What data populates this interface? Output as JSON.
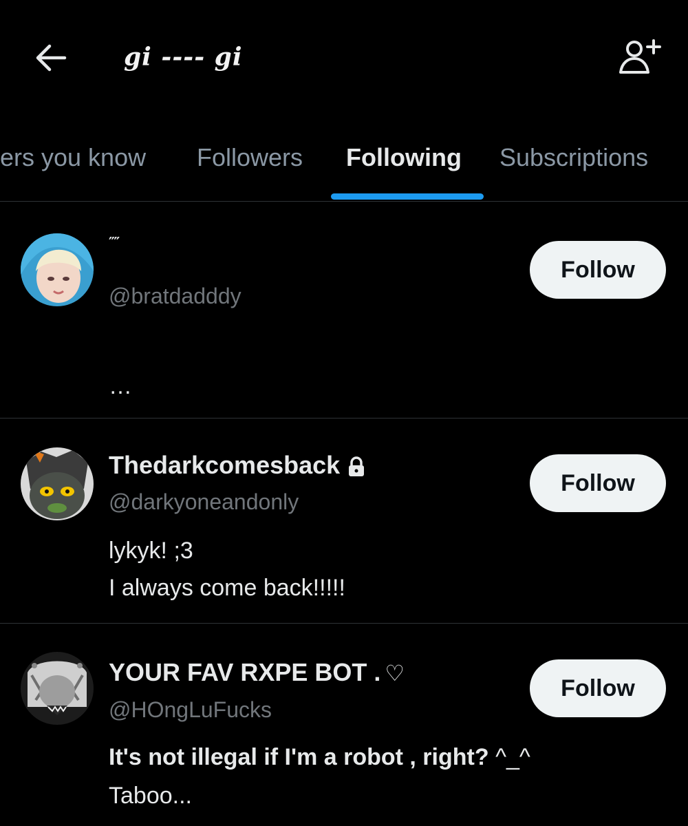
{
  "header": {
    "title": "gi ---- gi",
    "back_icon": "arrow-left-icon",
    "add_icon": "add-user-icon"
  },
  "tabs": [
    {
      "label": "ers you know",
      "active": false
    },
    {
      "label": "Followers",
      "active": false
    },
    {
      "label": "Following",
      "active": true
    },
    {
      "label": "Subscriptions",
      "active": false
    }
  ],
  "accent_color": "#1d9bf0",
  "users": [
    {
      "name": "⁗",
      "handle": "@bratdadddy",
      "bio": [
        "…"
      ],
      "button": "Follow"
    },
    {
      "name": "Thedarkcomesback",
      "protected": true,
      "handle": "@darkyoneandonly",
      "bio": [
        "lykyk! ;3",
        "I always come back!!!!!"
      ],
      "button": "Follow"
    },
    {
      "name": "YOUR FAV RXPE BOT .",
      "name_suffix": "♡",
      "handle": "@HOngLuFucks",
      "bio_bold": "It's not illegal if I'm a robot , right?",
      "bio_rest": " ^_^",
      "bio_line2": "Taboo...",
      "button": "Follow"
    }
  ]
}
